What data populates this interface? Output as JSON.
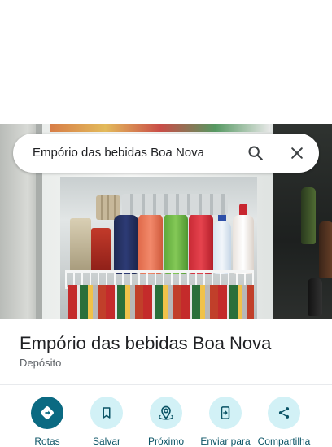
{
  "search": {
    "query": "Empório das bebidas Boa Nova",
    "search_icon": "search-icon",
    "close_icon": "close-icon"
  },
  "place": {
    "name": "Empório das bebidas Boa Nova",
    "category": "Depósito"
  },
  "actions": [
    {
      "label": "Rotas",
      "icon": "directions-icon",
      "primary": true
    },
    {
      "label": "Salvar",
      "icon": "bookmark-icon",
      "primary": false
    },
    {
      "label": "Próximo",
      "icon": "nearby-icon",
      "primary": false
    },
    {
      "label": "Enviar para",
      "icon": "send-to-phone-icon",
      "primary": false
    },
    {
      "label": "Compartilha",
      "icon": "share-icon",
      "primary": false
    }
  ],
  "colors": {
    "accent_dark": "#0b6a82",
    "accent_light": "#d2f1f6",
    "label_color": "#0b5466",
    "title_color": "#202124",
    "secondary_text": "#5f6368"
  }
}
